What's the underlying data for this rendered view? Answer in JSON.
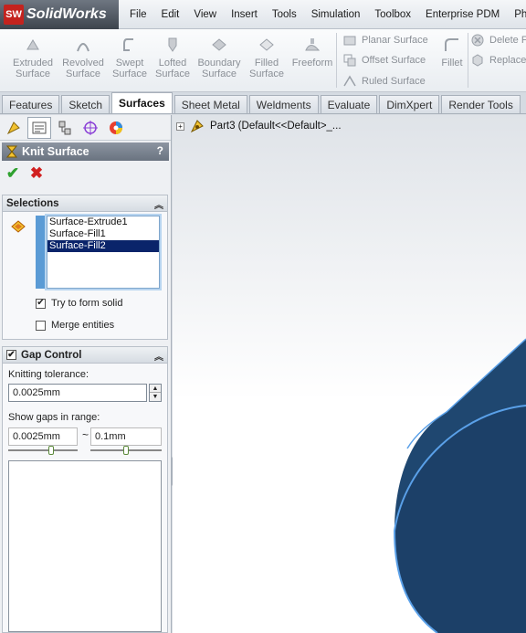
{
  "app": {
    "logo_badge": "SW",
    "logo_text": "SolidWorks"
  },
  "menu": [
    "File",
    "Edit",
    "View",
    "Insert",
    "Tools",
    "Simulation",
    "Toolbox",
    "Enterprise PDM",
    "PhotoVi"
  ],
  "ribbon": {
    "extruded_l1": "Extruded",
    "extruded_l2": "Surface",
    "revolved_l1": "Revolved",
    "revolved_l2": "Surface",
    "swept_l1": "Swept",
    "swept_l2": "Surface",
    "lofted_l1": "Lofted",
    "lofted_l2": "Surface",
    "boundary_l1": "Boundary",
    "boundary_l2": "Surface",
    "filled_l1": "Filled",
    "filled_l2": "Surface",
    "freeform": "Freeform",
    "planar": "Planar Surface",
    "offset": "Offset Surface",
    "ruled": "Ruled Surface",
    "fillet": "Fillet",
    "delete": "Delete F",
    "replace": "Replace"
  },
  "tabs": [
    "Features",
    "Sketch",
    "Surfaces",
    "Sheet Metal",
    "Weldments",
    "Evaluate",
    "DimXpert",
    "Render Tools"
  ],
  "active_tab": "Surfaces",
  "property_manager": {
    "title": "Knit Surface",
    "help": "?",
    "selections_header": "Selections",
    "selections": [
      "Surface-Extrude1",
      "Surface-Fill1",
      "Surface-Fill2"
    ],
    "selected_item": "Surface-Fill2",
    "try_solid_label": "Try to form solid",
    "try_solid_checked": true,
    "merge_label": "Merge entities",
    "merge_checked": false,
    "gap_header": "Gap Control",
    "gap_checked": true,
    "tolerance_label": "Knitting tolerance:",
    "tolerance_value": "0.0025mm",
    "range_label": "Show gaps in range:",
    "range_min": "0.0025mm",
    "range_tilde": "~",
    "range_max": "0.1mm"
  },
  "feature_tree": {
    "part_label": "Part3  (Default<<Default>_..."
  },
  "colors": {
    "accent": "#0a246a",
    "model_fill": "#1f4770",
    "model_edge": "#5aa0e8",
    "logo_red": "#c4231e"
  }
}
